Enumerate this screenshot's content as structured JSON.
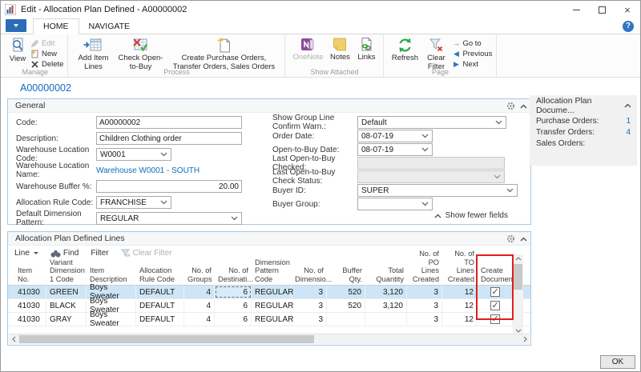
{
  "window": {
    "title": "Edit - Allocation Plan Defined - A00000002",
    "help": "?"
  },
  "colors": {
    "accent_blue": "#2f76c4",
    "link_blue": "#0f6cbd",
    "selection_blue": "#cde5f7",
    "highlight_red": "#e01e1e"
  },
  "ribbon": {
    "tabs": [
      {
        "label": "HOME"
      },
      {
        "label": "NAVIGATE"
      }
    ],
    "manage": {
      "label": "Manage",
      "view": "View",
      "edit": "Edit",
      "new": "New",
      "delete": "Delete"
    },
    "process": {
      "label": "Process",
      "add_item_lines": "Add Item Lines",
      "check_open_to_buy": "Check Open-to-Buy",
      "create_orders": "Create Purchase Orders, Transfer Orders, Sales Orders"
    },
    "show_attached": {
      "label": "Show Attached",
      "onenote": "OneNote",
      "notes": "Notes",
      "links": "Links"
    },
    "page": {
      "label": "Page",
      "refresh": "Refresh",
      "clear_filter": "Clear Filter",
      "go_to": "Go to",
      "previous": "Previous",
      "next": "Next"
    }
  },
  "page": {
    "title": "A00000002",
    "ok_label": "OK"
  },
  "general": {
    "title": "General",
    "show_fewer": "Show fewer fields",
    "left": [
      {
        "label": "Code:",
        "value": "A00000002"
      },
      {
        "label": "Description:",
        "value": "Children Clothing order"
      },
      {
        "label": "Warehouse Location Code:",
        "value": "W0001"
      },
      {
        "label": "Warehouse Location Name:",
        "value": "Warehouse W0001 - SOUTH"
      },
      {
        "label": "Warehouse Buffer %:",
        "value": "20.00"
      },
      {
        "label": "Allocation Rule Code:",
        "value": "FRANCHISE"
      },
      {
        "label": "Default Dimension Pattern:",
        "value": "REGULAR"
      }
    ],
    "right": [
      {
        "label": "Show Group Line Confirm Warn.:",
        "value": "Default"
      },
      {
        "label": "Order Date:",
        "value": "08-07-19"
      },
      {
        "label": "Open-to-Buy Date:",
        "value": "08-07-19"
      },
      {
        "label": "Last Open-to-Buy Checked:",
        "value": ""
      },
      {
        "label": "Last Open-to-Buy Check Status:",
        "value": ""
      },
      {
        "label": "Buyer ID:",
        "value": "SUPER"
      },
      {
        "label": "Buyer Group:",
        "value": ""
      }
    ]
  },
  "lines": {
    "title": "Allocation Plan Defined Lines",
    "toolbar": {
      "line": "Line",
      "find": "Find",
      "filter": "Filter",
      "clear_filter": "Clear Filter"
    },
    "columns": [
      "Item No.",
      "Variant Dimension 1 Code",
      "Item Description",
      "Allocation Rule Code",
      "No. of Groups",
      "No. of Destinati...",
      "Dimension Pattern Code",
      "No. of Dimensio...",
      "Buffer Qty.",
      "Total Quantity",
      "No. of PO Lines Created",
      "No. of TO Lines Created",
      "Create Documents"
    ],
    "rows": [
      {
        "cells": [
          "41030",
          "GREEN",
          "Boys Sweater",
          "DEFAULT",
          "4",
          "6",
          "REGULAR",
          "3",
          "520",
          "3,120",
          "3",
          "12"
        ],
        "create_documents": true
      },
      {
        "cells": [
          "41030",
          "BLACK",
          "Boys Sweater",
          "DEFAULT",
          "4",
          "6",
          "REGULAR",
          "3",
          "520",
          "3,120",
          "3",
          "12"
        ],
        "create_documents": true
      },
      {
        "cells": [
          "41030",
          "GRAY",
          "Boys Sweater",
          "DEFAULT",
          "4",
          "6",
          "REGULAR",
          "3",
          "",
          "",
          "3",
          "12"
        ],
        "create_documents": true
      }
    ]
  },
  "factbox": {
    "title": "Allocation Plan Docume...",
    "items": [
      {
        "label": "Purchase Orders:",
        "value": "1"
      },
      {
        "label": "Transfer Orders:",
        "value": "4"
      },
      {
        "label": "Sales Orders:",
        "value": ""
      }
    ]
  }
}
